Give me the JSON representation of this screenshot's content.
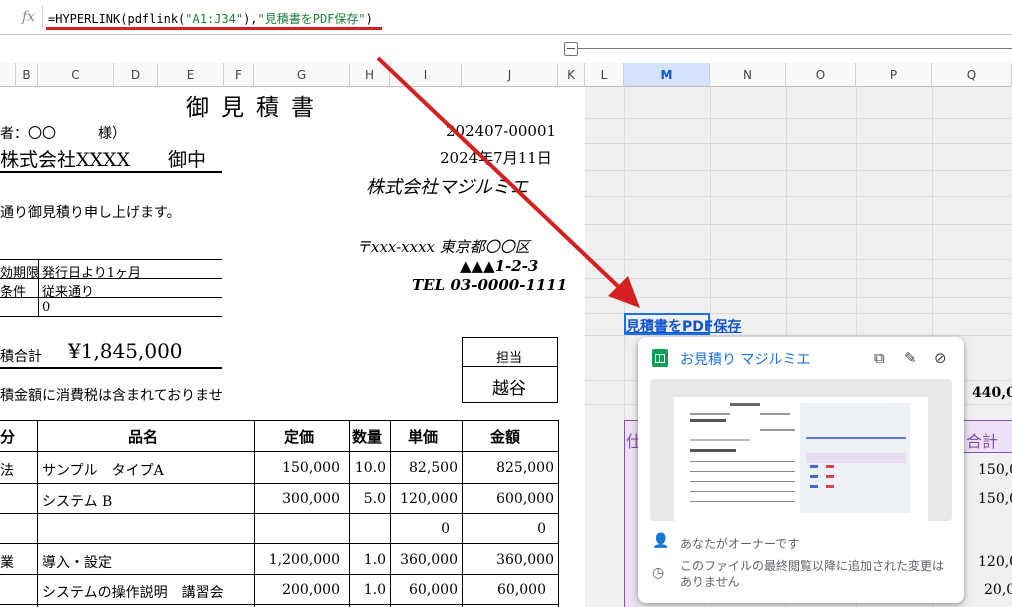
{
  "formula_bar": {
    "fx_label": "fx",
    "formula_prefix": "=HYPERLINK(pdflink(",
    "formula_arg1": "\"A1:J34\"",
    "formula_mid": "),",
    "formula_arg2": "\"見積書をPDF保存\"",
    "formula_suffix": ")"
  },
  "columns": [
    "B",
    "C",
    "D",
    "E",
    "F",
    "G",
    "H",
    "I",
    "J",
    "K",
    "L",
    "M",
    "N",
    "O",
    "P",
    "Q"
  ],
  "selected_column": "M",
  "quote": {
    "title": "御見積書",
    "recipient_label": "者：〇〇　　　様）",
    "company": "株式会社XXXX",
    "honorific": "御中",
    "quote_no": "202407-00001",
    "date": "2024年7月11日",
    "issuer": "株式会社マジルミエ",
    "greeting": "通り御見積り申し上げます。",
    "addr1": "〒xxx-xxxx 東京都〇〇区",
    "addr2": "▲▲▲1-2-3",
    "tel": "TEL 03-0000-1111",
    "validity_label": "効期限",
    "validity_value": "発行日より1ヶ月",
    "terms_label": "条件",
    "terms_value": "従来通り",
    "zero": "0",
    "total_label": "積合計",
    "total_value": "¥1,845,000",
    "staff_label": "担当",
    "staff_name": "越谷",
    "tax_note": "積金額に消費税は含まれておりませ",
    "headers": {
      "kubun": "分",
      "name": "品名",
      "list_price": "定価",
      "qty": "数量",
      "unit": "単価",
      "amount": "金額"
    },
    "rows": [
      {
        "kubun": "法",
        "name": "サンプル　タイプA",
        "list_price": "150,000",
        "qty": "10.0",
        "unit": "82,500",
        "amount": "825,000"
      },
      {
        "kubun": "",
        "name": "システム B",
        "list_price": "300,000",
        "qty": "5.0",
        "unit": "120,000",
        "amount": "600,000"
      },
      {
        "kubun": "",
        "name": "",
        "list_price": "",
        "qty": "",
        "unit": "0",
        "amount": "0"
      },
      {
        "kubun": "業",
        "name": "導入・設定",
        "list_price": "1,200,000",
        "qty": "1.0",
        "unit": "360,000",
        "amount": "360,000"
      },
      {
        "kubun": "",
        "name": "システムの操作説明　講習会",
        "list_price": "200,000",
        "qty": "1.0",
        "unit": "60,000",
        "amount": "60,000"
      }
    ]
  },
  "right_side": {
    "link_text": "見積書をPDF保存",
    "value_440": "440,0",
    "header_left": "仕",
    "header_right": "合計",
    "values": [
      "150,0",
      "150,0",
      "120,0",
      "20,0"
    ]
  },
  "popup": {
    "title": "お見積り マジルミエ",
    "owner_text": "あなたがオーナーです",
    "change_text_1": "このファイルの最終閲覧以降に追加された変更は",
    "change_text_2": "ありません",
    "icons": [
      "copy-icon",
      "edit-icon",
      "unlink-icon"
    ]
  },
  "colors": {
    "arrow": "#d32020",
    "link": "#1155cc",
    "accent": "#1a73e8"
  }
}
